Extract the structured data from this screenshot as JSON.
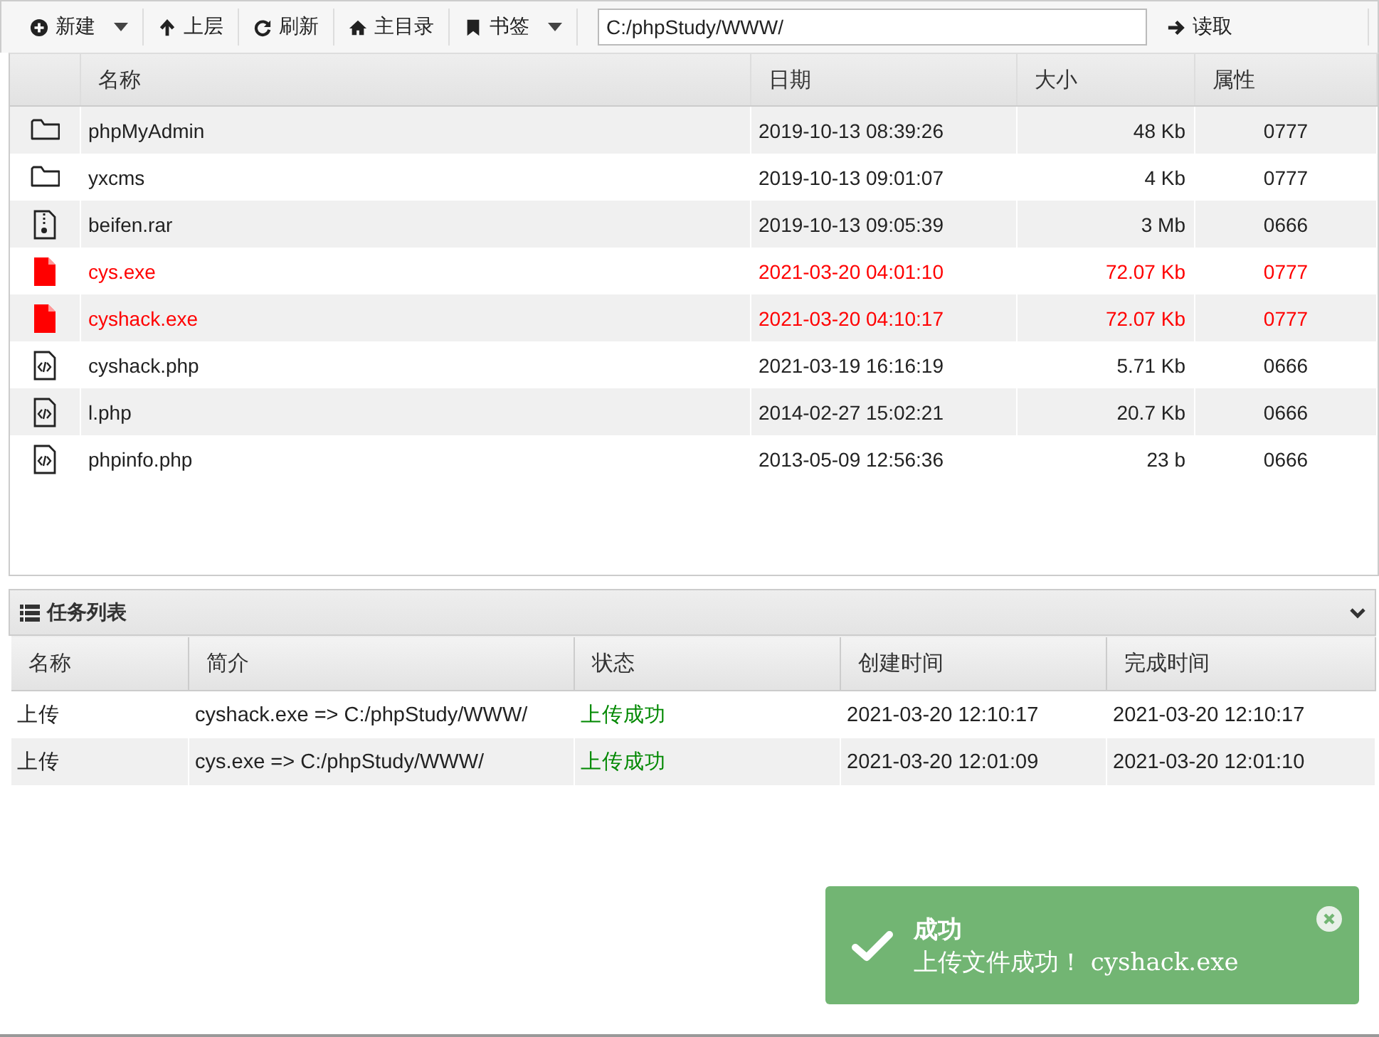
{
  "toolbar": {
    "buttons": [
      {
        "kind": "new",
        "label": "新建",
        "dropdown": true
      },
      {
        "kind": "up",
        "label": "上层",
        "dropdown": false
      },
      {
        "kind": "refresh",
        "label": "刷新",
        "dropdown": false
      },
      {
        "kind": "home",
        "label": "主目录",
        "dropdown": false
      },
      {
        "kind": "bookmark",
        "label": "书签",
        "dropdown": true
      }
    ],
    "path": "C:/phpStudy/WWW/",
    "read_button": "读取"
  },
  "files": {
    "columns": [
      "名称",
      "日期",
      "大小",
      "属性"
    ],
    "rows": [
      {
        "kind": "folder",
        "name": "phpMyAdmin",
        "date": "2019-10-13 08:39:26",
        "size": "48 Kb",
        "attr": "0777",
        "flagged": false
      },
      {
        "kind": "folder",
        "name": "yxcms",
        "date": "2019-10-13 09:01:07",
        "size": "4 Kb",
        "attr": "0777",
        "flagged": false
      },
      {
        "kind": "archive",
        "name": "beifen.rar",
        "date": "2019-10-13 09:05:39",
        "size": "3 Mb",
        "attr": "0666",
        "flagged": false
      },
      {
        "kind": "file",
        "name": "cys.exe",
        "date": "2021-03-20 04:01:10",
        "size": "72.07 Kb",
        "attr": "0777",
        "flagged": true
      },
      {
        "kind": "file",
        "name": "cyshack.exe",
        "date": "2021-03-20 04:10:17",
        "size": "72.07 Kb",
        "attr": "0777",
        "flagged": true
      },
      {
        "kind": "code",
        "name": "cyshack.php",
        "date": "2021-03-19 16:16:19",
        "size": "5.71 Kb",
        "attr": "0666",
        "flagged": false
      },
      {
        "kind": "code",
        "name": "l.php",
        "date": "2014-02-27 15:02:21",
        "size": "20.7 Kb",
        "attr": "0666",
        "flagged": false
      },
      {
        "kind": "code",
        "name": "phpinfo.php",
        "date": "2013-05-09 12:56:36",
        "size": "23 b",
        "attr": "0666",
        "flagged": false
      }
    ]
  },
  "tasks": {
    "title": "任务列表",
    "expanded": true,
    "columns": [
      "名称",
      "简介",
      "状态",
      "创建时间",
      "完成时间"
    ],
    "rows": [
      [
        "上传",
        "cyshack.exe => C:/phpStudy/WWW/",
        "上传成功",
        "2021-03-20 12:10:17",
        "2021-03-20 12:10:17"
      ],
      [
        "上传",
        "cys.exe => C:/phpStudy/WWW/",
        "上传成功",
        "2021-03-20 12:01:09",
        "2021-03-20 12:01:10"
      ]
    ]
  },
  "toast": {
    "title": "成功",
    "message": "上传文件成功！ cyshack.exe"
  }
}
